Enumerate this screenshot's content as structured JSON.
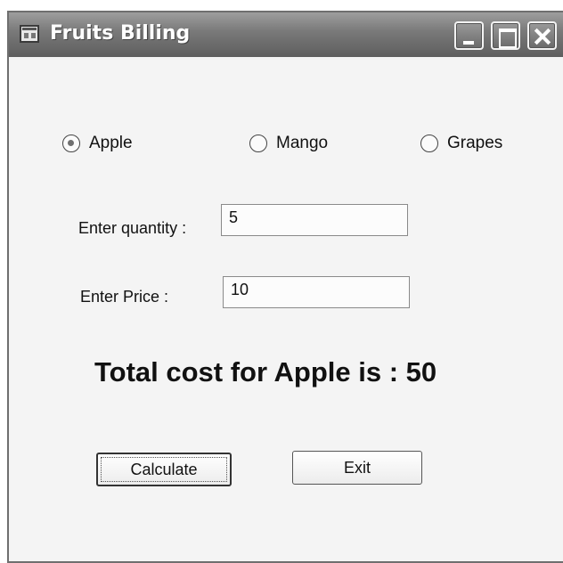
{
  "window": {
    "title": "Fruits Billing",
    "icon": "app-window-icon",
    "controls": [
      "minimize-icon",
      "maximize-icon",
      "close-icon"
    ]
  },
  "fruits": {
    "options": [
      {
        "label": "Apple",
        "checked": true
      },
      {
        "label": "Mango",
        "checked": false
      },
      {
        "label": "Grapes",
        "checked": false
      }
    ]
  },
  "form": {
    "quantity_label": "Enter quantity :",
    "quantity_value": "5",
    "price_label": "Enter Price :",
    "price_value": "10"
  },
  "result": {
    "text": "Total cost for Apple is : 50"
  },
  "buttons": {
    "calculate_label": "Calculate",
    "exit_label": "Exit"
  }
}
